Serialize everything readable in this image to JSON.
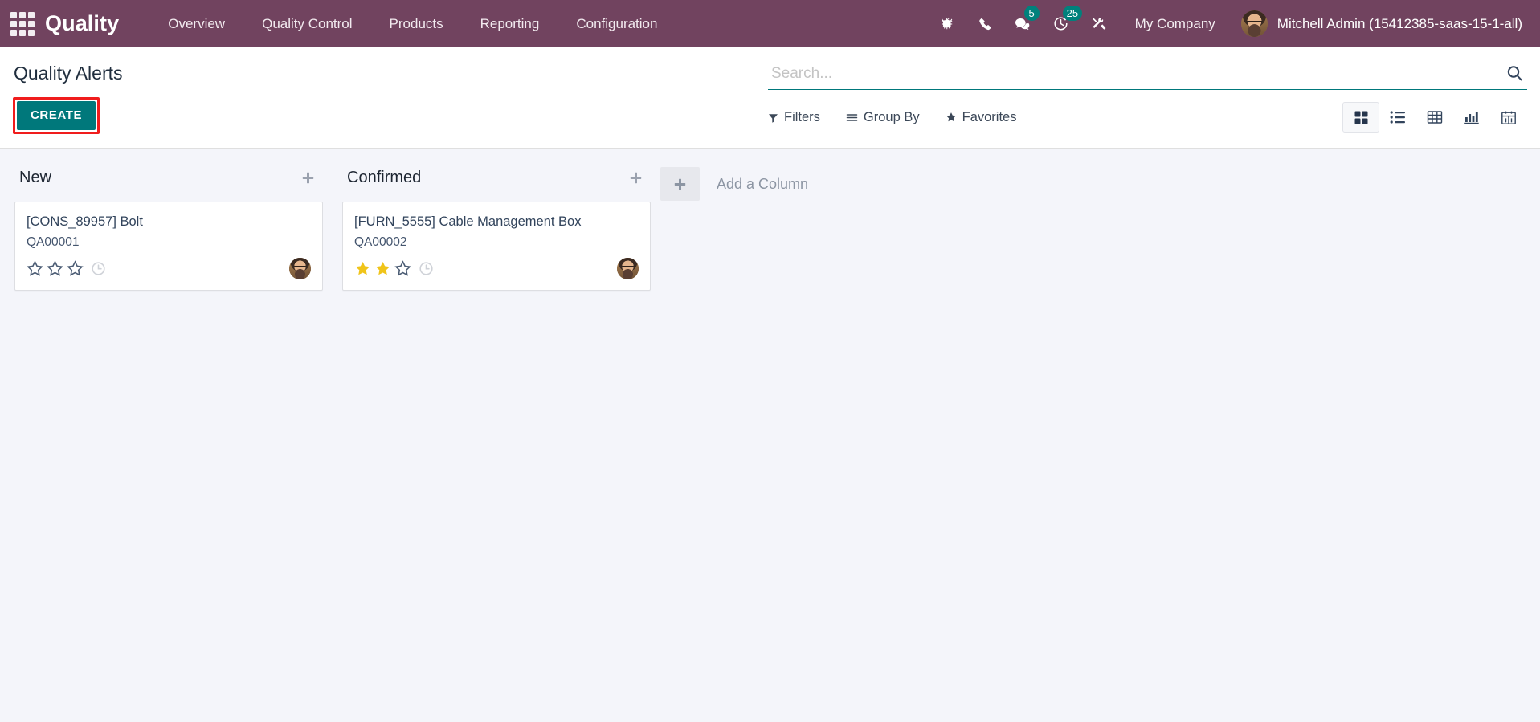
{
  "navbar": {
    "apps_icon": "apps-grid-icon",
    "brand": "Quality",
    "menu": [
      {
        "label": "Overview"
      },
      {
        "label": "Quality Control"
      },
      {
        "label": "Products"
      },
      {
        "label": "Reporting"
      },
      {
        "label": "Configuration"
      }
    ],
    "icons": [
      {
        "name": "bug-icon",
        "badge": ""
      },
      {
        "name": "phone-icon",
        "badge": ""
      },
      {
        "name": "messages-icon",
        "badge": "5"
      },
      {
        "name": "activity-clock-icon",
        "badge": "25"
      },
      {
        "name": "tools-icon",
        "badge": ""
      }
    ],
    "company": "My Company",
    "user": "Mitchell Admin (15412385-saas-15-1-all)",
    "background_color": "#71435F",
    "badge_color": "#00817C"
  },
  "control_panel": {
    "title": "Quality Alerts",
    "create_label": "CREATE",
    "create_color": "#00787B",
    "highlight_color": "#F01D1D",
    "search": {
      "value": "",
      "placeholder": "Search...",
      "icon": "search-icon"
    },
    "filter_buttons": [
      {
        "label": "Filters",
        "icon": "funnel-icon"
      },
      {
        "label": "Group By",
        "icon": "list-lines-icon"
      },
      {
        "label": "Favorites",
        "icon": "star-icon"
      }
    ],
    "views": [
      {
        "name": "kanban",
        "active": true
      },
      {
        "name": "list",
        "active": false
      },
      {
        "name": "pivot",
        "active": false
      },
      {
        "name": "graph",
        "active": false
      },
      {
        "name": "calendar",
        "active": false
      }
    ]
  },
  "kanban": {
    "background_color": "#F4F5FA",
    "columns": [
      {
        "title": "New",
        "add_icon": "plus-icon",
        "cards": [
          {
            "title": "[CONS_89957] Bolt",
            "reference": "QA00001",
            "stars_filled": 0,
            "stars_total": 3,
            "clock_icon": "clock-icon",
            "avatar": "user-avatar"
          }
        ]
      },
      {
        "title": "Confirmed",
        "add_icon": "plus-icon",
        "cards": [
          {
            "title": "[FURN_5555] Cable Management Box",
            "reference": "QA00002",
            "stars_filled": 2,
            "stars_total": 3,
            "clock_icon": "clock-icon",
            "avatar": "user-avatar"
          }
        ]
      }
    ],
    "add_column": {
      "icon": "plus-icon",
      "label": "Add a Column"
    },
    "star_filled_color": "#F0C419",
    "star_empty_color": "#4B5C74"
  }
}
